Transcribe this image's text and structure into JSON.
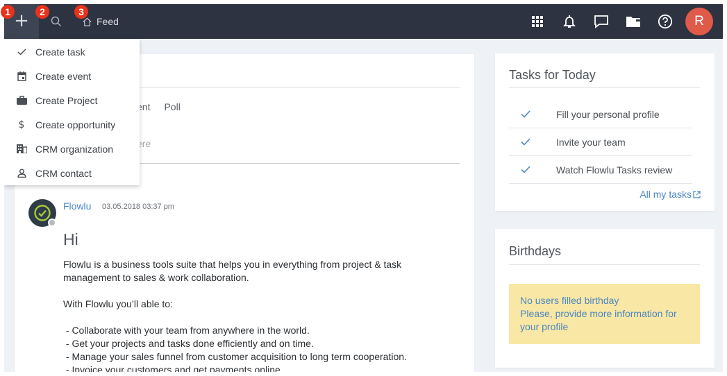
{
  "topbar": {
    "plus_glyph": "+",
    "feed_label": "Feed",
    "avatar_letter": "R",
    "icons": [
      "plus-icon",
      "search-icon",
      "home-icon",
      "apps-grid-icon",
      "bell-icon",
      "chat-icon",
      "folder-icon",
      "help-icon"
    ]
  },
  "markers": [
    "1",
    "2",
    "3"
  ],
  "dropdown": {
    "items": [
      {
        "label": "Create task",
        "icon": "check-icon"
      },
      {
        "label": "Create event",
        "icon": "calendar-icon"
      },
      {
        "label": "Create Project",
        "icon": "briefcase-icon"
      },
      {
        "label": "Create opportunity",
        "icon": "dollar-icon"
      },
      {
        "label": "CRM organization",
        "icon": "building-icon"
      },
      {
        "label": "CRM contact",
        "icon": "person-icon"
      }
    ]
  },
  "composer": {
    "tab_partial": "ent",
    "tab_poll": "Poll",
    "placeholder_partial": "ere"
  },
  "post": {
    "author": "Flowlu",
    "date": "03.05.2018 03:37 pm",
    "title": "Hi",
    "intro": "Flowlu is a business tools suite that helps you in everything from project & task management to sales & work collaboration.",
    "able_to": "With Flowlu you’ll able to:",
    "bullets": [
      " - Collaborate with your team from anywhere in the world.",
      " - Get your projects and tasks done efficiently and on time.",
      " - Manage your sales funnel from customer acquisition to long term cooperation.",
      " - Invoice your customers and get payments online."
    ]
  },
  "tasks": {
    "title": "Tasks for Today",
    "items": [
      "Fill your personal profile",
      "Invite your team",
      "Watch Flowlu Tasks review"
    ],
    "all_link": "All my tasks"
  },
  "birthdays": {
    "title": "Birthdays",
    "note_line1": "No users filled birthday",
    "note_line2": "Please, provide more information for your profile"
  },
  "colors": {
    "topbar": "#2d3340",
    "accent_blue": "#4b86c1",
    "avatar": "#e05a4a",
    "marker": "#e8331c",
    "note_bg": "#f9e7a5"
  }
}
